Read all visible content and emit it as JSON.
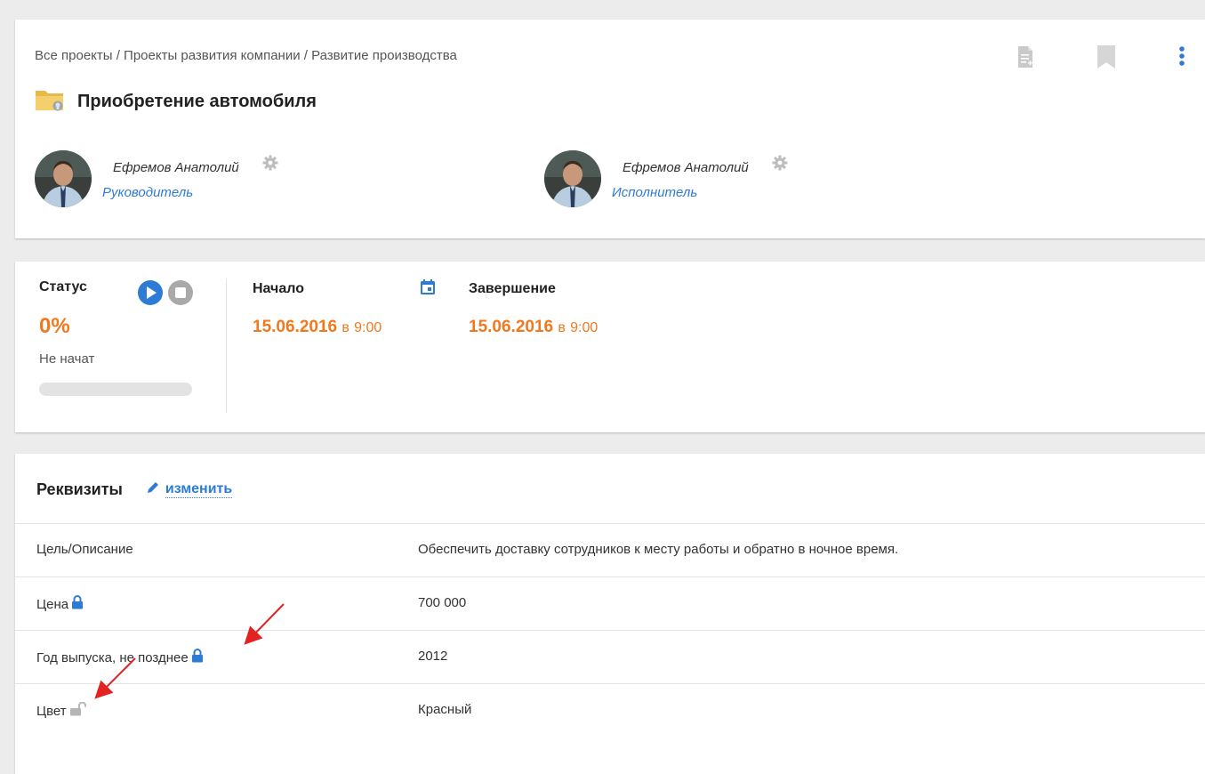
{
  "header": {
    "breadcrumb": "Все проекты / Проекты развития компании / Развитие производства",
    "title": "Приобретение автомобиля",
    "actions": [
      "document-icon",
      "bookmark-icon",
      "more-vert-icon"
    ]
  },
  "people": [
    {
      "name": "Ефремов Анатолий",
      "role": "Руководитель"
    },
    {
      "name": "Ефремов Анатолий",
      "role": "Исполнитель"
    }
  ],
  "status": {
    "label": "Статус",
    "percent_text": "0%",
    "progress": 0,
    "state": "Не начат"
  },
  "dates": {
    "start": {
      "label": "Начало",
      "date": "15.06.2016",
      "sep": "в",
      "time": "9:00"
    },
    "end": {
      "label": "Завершение",
      "date": "15.06.2016",
      "sep": "в",
      "time": "9:00"
    }
  },
  "requisites": {
    "title": "Реквизиты",
    "edit_label": "изменить",
    "rows": [
      {
        "label": "Цель/Описание",
        "value": "Обеспечить доставку сотрудников к месту работы и обратно в ночное время.",
        "lock": "none"
      },
      {
        "label": "Цена",
        "value": "700 000",
        "lock": "locked"
      },
      {
        "label": "Год выпуска, не позднее",
        "value": "2012",
        "lock": "locked"
      },
      {
        "label": "Цвет",
        "value": "Красный",
        "lock": "unlocked"
      }
    ]
  },
  "colors": {
    "accent": "#2e7bd6",
    "orange": "#f2781e",
    "arrow": "#e32222"
  }
}
